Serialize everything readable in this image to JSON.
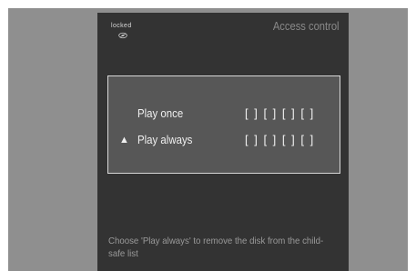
{
  "status": {
    "locked_label": "locked"
  },
  "header": {
    "title": "Access control"
  },
  "options": [
    {
      "label": "Play once",
      "code_slots": "[ ] [ ] [ ] [ ]",
      "selected": false
    },
    {
      "label": "Play always",
      "code_slots": "[ ] [ ] [ ] [ ]",
      "selected": true
    }
  ],
  "selector": {
    "glyph": "▲"
  },
  "help": {
    "text": "Choose 'Play always' to remove the disk from the child-safe list"
  },
  "colors": {
    "backdrop": "#8f8f8f",
    "panel": "#333333",
    "box": "#575757",
    "text": "#f0f0f0",
    "muted_text": "#9a9a9a"
  },
  "icons": {
    "disc": "disc-icon",
    "selector": "up-triangle-icon"
  }
}
